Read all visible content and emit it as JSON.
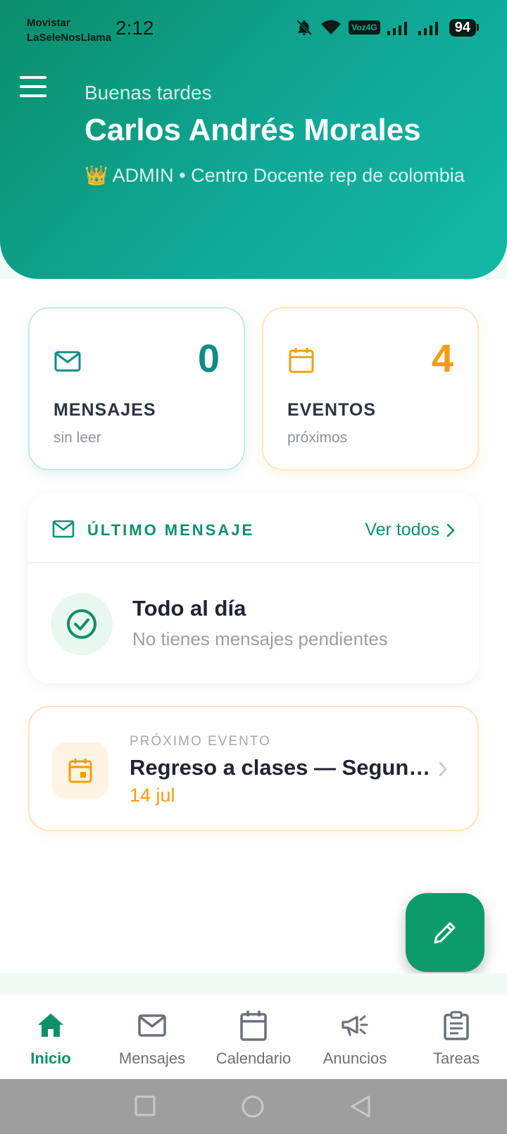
{
  "status_bar": {
    "carrier_line1": "Movistar",
    "carrier_line2": "LaSeleNosLlama",
    "time": "2:12",
    "volte": "Voz4G",
    "battery": "94"
  },
  "header": {
    "greeting": "Buenas tardes",
    "user_name": "Carlos Andrés Morales",
    "role_line": "👑 ADMIN • Centro Docente rep de colombia"
  },
  "stats": {
    "messages": {
      "count": "0",
      "title": "MENSAJES",
      "subtitle": "sin leer"
    },
    "events": {
      "count": "4",
      "title": "EVENTOS",
      "subtitle": "próximos"
    }
  },
  "last_message": {
    "title": "ÚLTIMO MENSAJE",
    "see_all": "Ver todos",
    "empty_title": "Todo al día",
    "empty_subtitle": "No tienes mensajes pendientes"
  },
  "next_event": {
    "label": "PRÓXIMO EVENTO",
    "title": "Regreso a clases — Segundo semestre",
    "date": "14 jul"
  },
  "bottom_nav": {
    "items": [
      {
        "label": "Inicio",
        "icon": "home-icon",
        "active": true
      },
      {
        "label": "Mensajes",
        "icon": "mail-icon",
        "active": false
      },
      {
        "label": "Calendario",
        "icon": "calendar-icon",
        "active": false
      },
      {
        "label": "Anuncios",
        "icon": "megaphone-icon",
        "active": false
      },
      {
        "label": "Tareas",
        "icon": "clipboard-icon",
        "active": false
      }
    ]
  },
  "colors": {
    "primary": "#0d9b6c",
    "teal": "#128b84",
    "orange": "#f39c12"
  }
}
